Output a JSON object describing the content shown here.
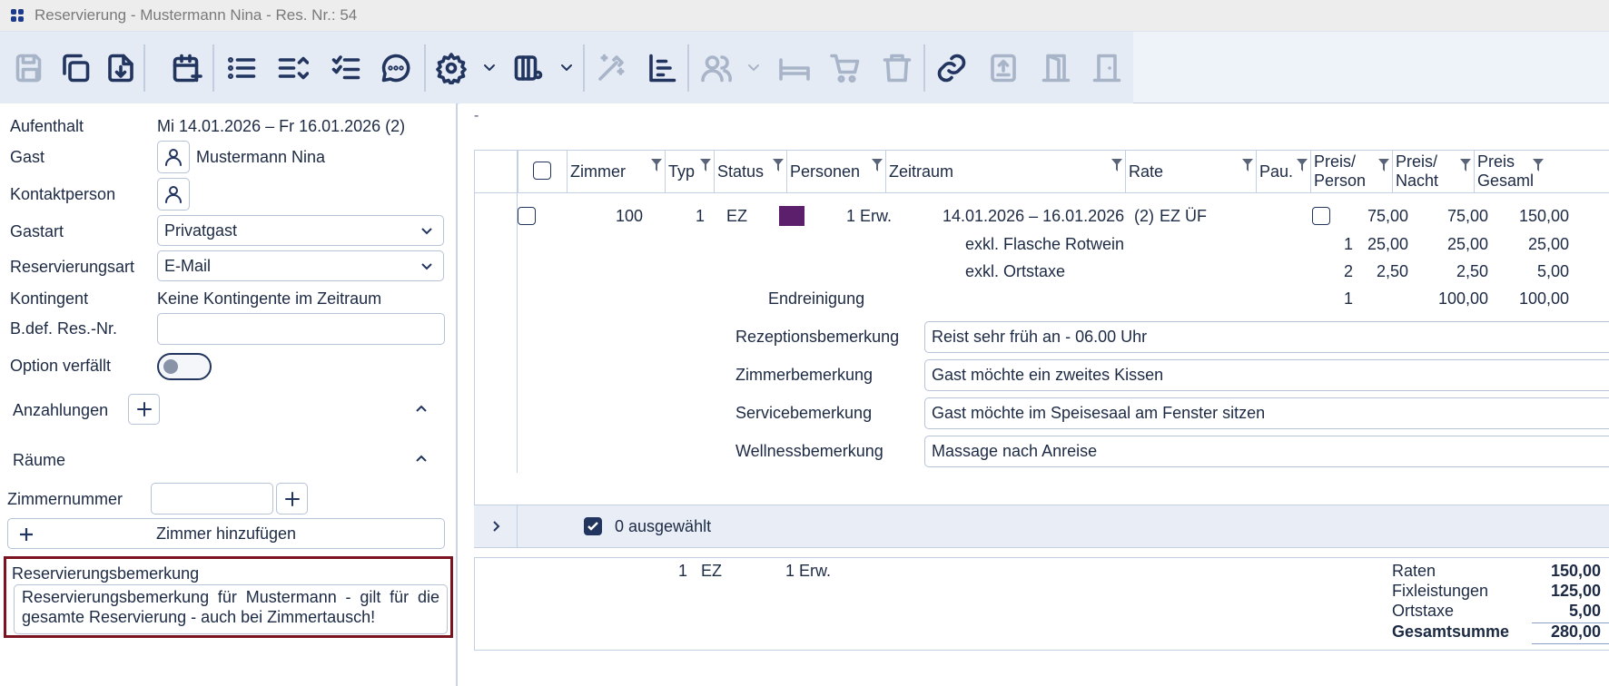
{
  "window": {
    "title": "Reservierung - Mustermann Nina - Res. Nr.: 54"
  },
  "toolbar": {
    "buttons": [
      {
        "name": "save-icon",
        "enabled": false
      },
      {
        "name": "copy-icon",
        "enabled": true
      },
      {
        "name": "download-icon",
        "enabled": true
      },
      {
        "name": "calendar-add-icon",
        "enabled": true
      },
      {
        "name": "list-icon",
        "enabled": true
      },
      {
        "name": "list-sort-icon",
        "enabled": true
      },
      {
        "name": "checklist-icon",
        "enabled": true
      },
      {
        "name": "chat-icon",
        "enabled": true
      },
      {
        "name": "gear-icon",
        "enabled": true
      },
      {
        "name": "layout-settings-icon",
        "enabled": true
      },
      {
        "name": "magic-wand-icon",
        "enabled": false
      },
      {
        "name": "chart-icon",
        "enabled": true
      },
      {
        "name": "guests-icon",
        "enabled": false
      },
      {
        "name": "bed-icon",
        "enabled": false
      },
      {
        "name": "cart-icon",
        "enabled": false
      },
      {
        "name": "trash-icon",
        "enabled": false
      },
      {
        "name": "link-icon",
        "enabled": true
      },
      {
        "name": "upload-icon",
        "enabled": false
      },
      {
        "name": "door-open-icon",
        "enabled": false
      },
      {
        "name": "door-closed-icon",
        "enabled": false
      }
    ]
  },
  "left": {
    "aufenthalt_label": "Aufenthalt",
    "aufenthalt_value": "Mi 14.01.2026 – Fr 16.01.2026 (2)",
    "gast_label": "Gast",
    "gast_value": "Mustermann Nina",
    "kontakt_label": "Kontaktperson",
    "gastart_label": "Gastart",
    "gastart_value": "Privatgast",
    "resart_label": "Reservierungsart",
    "resart_value": "E-Mail",
    "kontingent_label": "Kontingent",
    "kontingent_value": "Keine Kontingente im Zeitraum",
    "bdef_label": "B.def. Res.-Nr.",
    "bdef_value": "",
    "option_label": "Option verfällt",
    "option_on": false,
    "anzahlungen_label": "Anzahlungen",
    "raeume_label": "Räume",
    "zimmernummer_label": "Zimmernummer",
    "zimmernummer_value": "",
    "add_room_label": "Zimmer hinzufügen",
    "res_remark_label": "Reservierungsbemerkung",
    "res_remark_value": "Reservierungsbemerkung für Mustermann - gilt für die gesamte Reservierung - auch bei Zimmertausch!"
  },
  "main": {
    "dash": "-",
    "headers": {
      "zimmer": "Zimmer",
      "typ": "Typ",
      "status": "Status",
      "personen": "Personen",
      "zeitraum": "Zeitraum",
      "rate": "Rate",
      "pau": "Pau.",
      "preis_person_1": "Preis/",
      "preis_person_2": "Person",
      "preis_nacht_1": "Preis/",
      "preis_nacht_2": "Nacht",
      "preis_gesamt_1": "Preis",
      "preis_gesamt_2": "Gesaml"
    },
    "row": {
      "zimmer": "100",
      "anzahl": "1",
      "typ": "EZ",
      "status_color": "#5b1f6b",
      "personen": "1 Erw.",
      "zeitraum": "14.01.2026 – 16.01.2026",
      "naechte": "(2)",
      "rate": "EZ ÜF",
      "preis_person": "75,00",
      "preis_nacht": "75,00",
      "preis_gesamt": "150,00"
    },
    "extras": [
      {
        "label": "exkl. Flasche Rotwein",
        "qty": "1",
        "person": "25,00",
        "nacht": "25,00",
        "gesamt": "25,00"
      },
      {
        "label": "exkl. Ortstaxe",
        "qty": "2",
        "person": "2,50",
        "nacht": "2,50",
        "gesamt": "5,00"
      },
      {
        "label": "Endreinigung",
        "qty": "1",
        "person": "",
        "nacht": "100,00",
        "gesamt": "100,00"
      }
    ],
    "remarks": [
      {
        "label": "Rezeptionsbemerkung",
        "value": "Reist sehr früh an - 06.00 Uhr"
      },
      {
        "label": "Zimmerbemerkung",
        "value": "Gast möchte ein zweites Kissen"
      },
      {
        "label": "Servicebemerkung",
        "value": "Gast möchte im Speisesaal am Fenster sitzen"
      },
      {
        "label": "Wellnessbemerkung",
        "value": "Massage nach Anreise"
      }
    ],
    "selection_text": "0 ausgewählt",
    "summary": {
      "anzahl": "1",
      "typ": "EZ",
      "personen": "1 Erw.",
      "raten_label": "Raten",
      "raten_value": "150,00",
      "fix_label": "Fixleistungen",
      "fix_value": "125,00",
      "ortstaxe_label": "Ortstaxe",
      "ortstaxe_value": "5,00",
      "gesamt_label": "Gesamtsumme",
      "gesamt_value": "280,00"
    }
  }
}
